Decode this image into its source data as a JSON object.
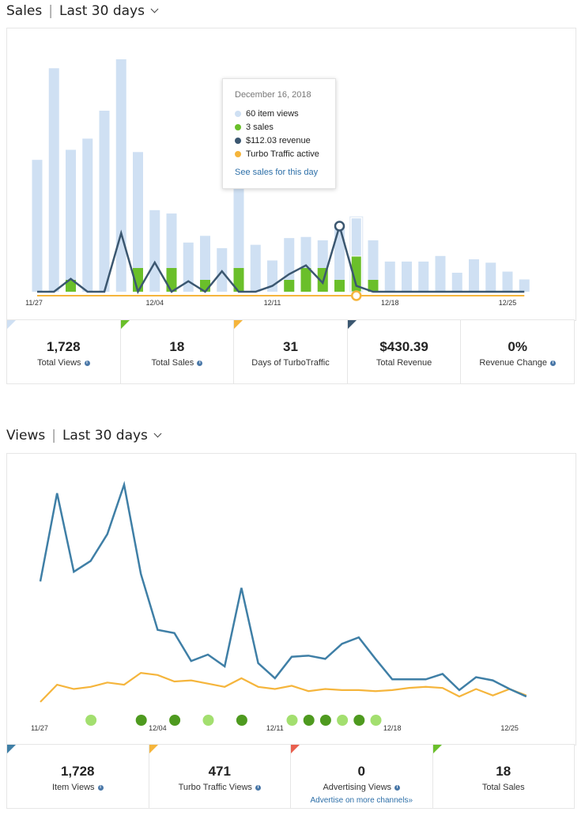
{
  "sales_header": {
    "title": "Sales",
    "range": "Last 30 days"
  },
  "views_header": {
    "title": "Views",
    "range": "Last 30 days"
  },
  "colors": {
    "views_bar": "#cfe0f3",
    "sales_bar": "#6abf2a",
    "revenue_line": "#3b5770",
    "turbo_line": "#f5b53c",
    "views_line": "#3f7fa6",
    "light_green": "#a3df6f",
    "dark_green": "#4e9a1f",
    "red_corner": "#e9604f"
  },
  "tooltip": {
    "date": "December 16, 2018",
    "views": "60 item views",
    "sales": "3 sales",
    "revenue": "$112.03 revenue",
    "turbo": "Turbo Traffic active",
    "link": "See sales for this day"
  },
  "sales_stats": [
    {
      "value": "1,728",
      "label": "Total Views",
      "info": true,
      "corner": "views_bar"
    },
    {
      "value": "18",
      "label": "Total Sales",
      "info": true,
      "corner": "sales_bar"
    },
    {
      "value": "31",
      "label": "Days of TurboTraffic",
      "info": false,
      "corner": "turbo_line"
    },
    {
      "value": "$430.39",
      "label": "Total Revenue",
      "info": false,
      "corner": "revenue_line"
    },
    {
      "value": "0%",
      "label": "Revenue Change",
      "info": true,
      "corner": "none"
    }
  ],
  "views_stats": [
    {
      "value": "1,728",
      "label": "Item Views",
      "info": true,
      "corner": "views_line"
    },
    {
      "value": "471",
      "label": "Turbo Traffic Views",
      "info": true,
      "corner": "turbo_line"
    },
    {
      "value": "0",
      "label": "Advertising Views",
      "info": true,
      "corner": "red_corner",
      "link": "Advertise on more channels»"
    },
    {
      "value": "18",
      "label": "Total Sales",
      "info": false,
      "corner": "sales_bar"
    }
  ],
  "chart_data": [
    {
      "type": "bar",
      "x_tick_labels": [
        "11/27",
        "12/04",
        "12/11",
        "12/18",
        "12/25"
      ],
      "x_tick_index": [
        0,
        7,
        14,
        21,
        28
      ],
      "highlight_index": 19,
      "views": [
        118,
        200,
        127,
        137,
        162,
        208,
        125,
        73,
        70,
        44,
        50,
        39,
        112,
        42,
        28,
        48,
        49,
        46,
        60,
        66,
        46,
        27,
        27,
        27,
        32,
        17,
        29,
        26,
        18,
        11
      ],
      "sales": [
        0,
        0,
        1,
        0,
        0,
        0,
        2,
        0,
        2,
        0,
        1,
        0,
        2,
        0,
        0,
        1,
        2,
        2,
        1,
        3,
        1,
        0,
        0,
        0,
        0,
        0,
        0,
        0,
        0,
        0
      ],
      "revenue": [
        0,
        0,
        22,
        0,
        0,
        100,
        0,
        50,
        0,
        18,
        0,
        35,
        0,
        0,
        10,
        30,
        45,
        15,
        112.03,
        10,
        0,
        0,
        0,
        0,
        0,
        0,
        0,
        0,
        0,
        0
      ]
    },
    {
      "type": "line",
      "x_tick_labels": [
        "11/27",
        "12/04",
        "12/11",
        "12/18",
        "12/25"
      ],
      "x_tick_index": [
        0,
        7,
        14,
        21,
        28
      ],
      "item_views": [
        118,
        200,
        127,
        137,
        162,
        208,
        125,
        73,
        70,
        44,
        50,
        39,
        112,
        42,
        28,
        48,
        49,
        46,
        60,
        66,
        46,
        27,
        27,
        27,
        32,
        17,
        29,
        26,
        18,
        11
      ],
      "turbo_views": [
        6,
        22,
        18,
        20,
        24,
        22,
        33,
        31,
        25,
        26,
        23,
        20,
        28,
        20,
        18,
        21,
        16,
        18,
        17,
        17,
        16,
        17,
        19,
        20,
        19,
        11,
        18,
        12,
        18,
        12
      ],
      "sale_days": [
        {
          "index": 3,
          "count": 1
        },
        {
          "index": 6,
          "count": 2
        },
        {
          "index": 8,
          "count": 2
        },
        {
          "index": 10,
          "count": 1
        },
        {
          "index": 12,
          "count": 2
        },
        {
          "index": 15,
          "count": 1
        },
        {
          "index": 16,
          "count": 2
        },
        {
          "index": 17,
          "count": 2
        },
        {
          "index": 18,
          "count": 1
        },
        {
          "index": 19,
          "count": 3
        },
        {
          "index": 20,
          "count": 1
        }
      ]
    }
  ]
}
